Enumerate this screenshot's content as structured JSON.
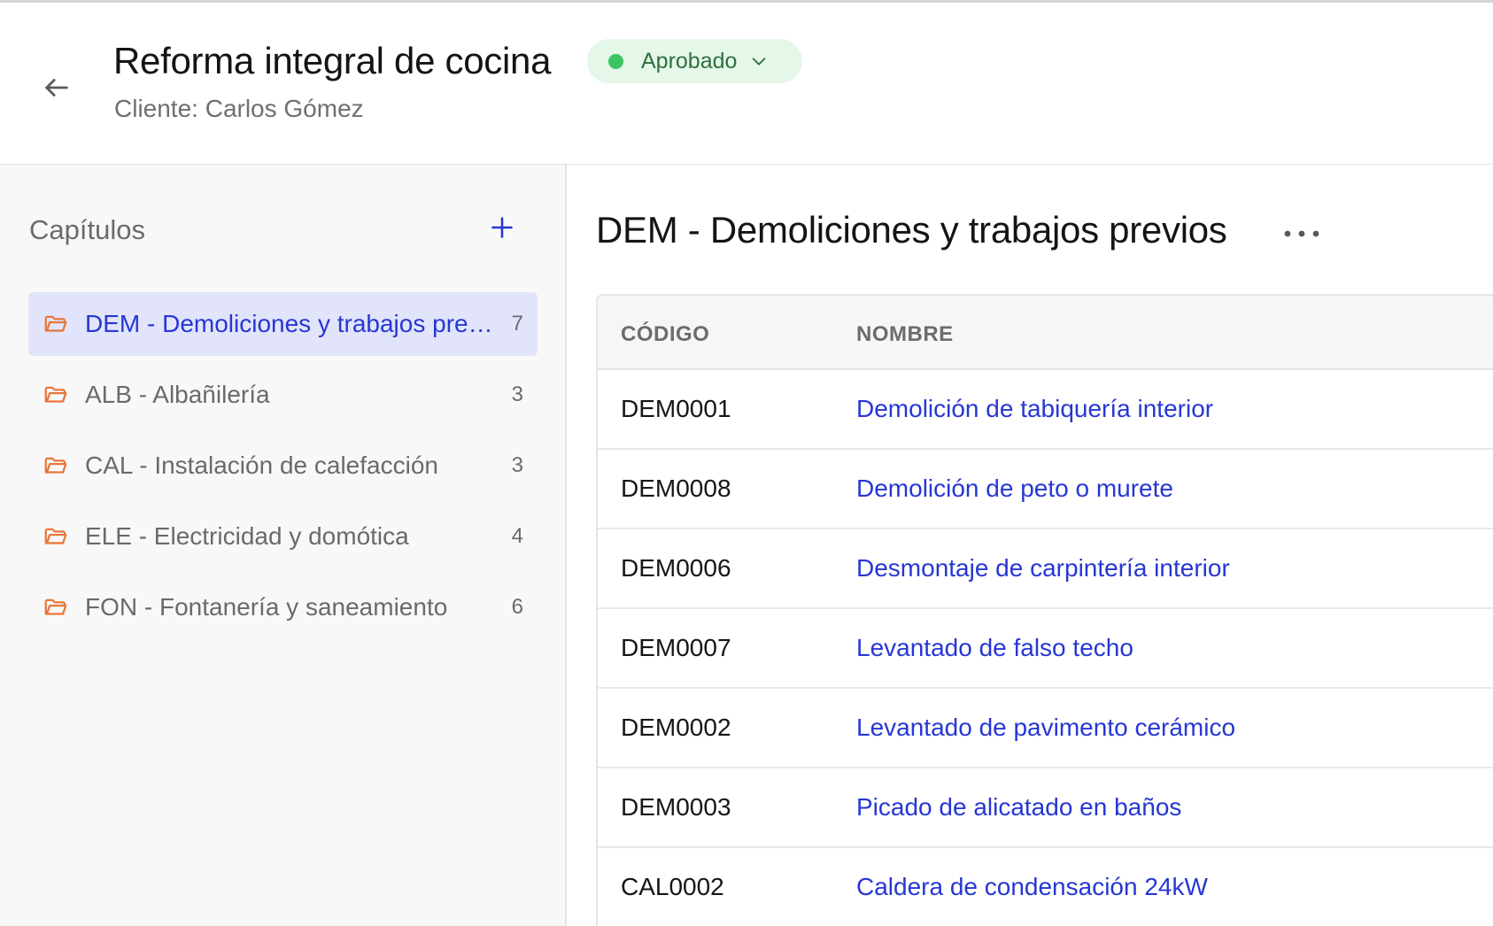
{
  "header": {
    "title": "Reforma integral de cocina",
    "client": "Cliente: Carlos Gómez",
    "status": "Aprobado",
    "status_color": "#3cc463"
  },
  "sidebar": {
    "title": "Capítulos",
    "chapters": [
      {
        "label": "DEM - Demoliciones y trabajos previos",
        "count": "7",
        "active": true
      },
      {
        "label": "ALB - Albañilería",
        "count": "3"
      },
      {
        "label": "CAL - Instalación de calefacción",
        "count": "3"
      },
      {
        "label": "ELE - Electricidad y domótica",
        "count": "4"
      },
      {
        "label": "FON - Fontanería y saneamiento",
        "count": "6"
      }
    ]
  },
  "main": {
    "heading": "DEM - Demoliciones y trabajos previos",
    "columns": {
      "code": "CÓDIGO",
      "name": "NOMBRE"
    },
    "rows": [
      {
        "code": "DEM0001",
        "name": "Demolición de tabiquería interior"
      },
      {
        "code": "DEM0008",
        "name": "Demolición de peto o murete"
      },
      {
        "code": "DEM0006",
        "name": "Desmontaje de carpintería interior"
      },
      {
        "code": "DEM0007",
        "name": "Levantado de falso techo"
      },
      {
        "code": "DEM0002",
        "name": "Levantado de pavimento cerámico"
      },
      {
        "code": "DEM0003",
        "name": "Picado de alicatado en baños"
      },
      {
        "code": "CAL0002",
        "name": "Caldera de condensación 24kW"
      }
    ]
  },
  "colors": {
    "accent": "#2637d4",
    "folder": "#e8763a",
    "active_bg": "#e1e4fb"
  }
}
